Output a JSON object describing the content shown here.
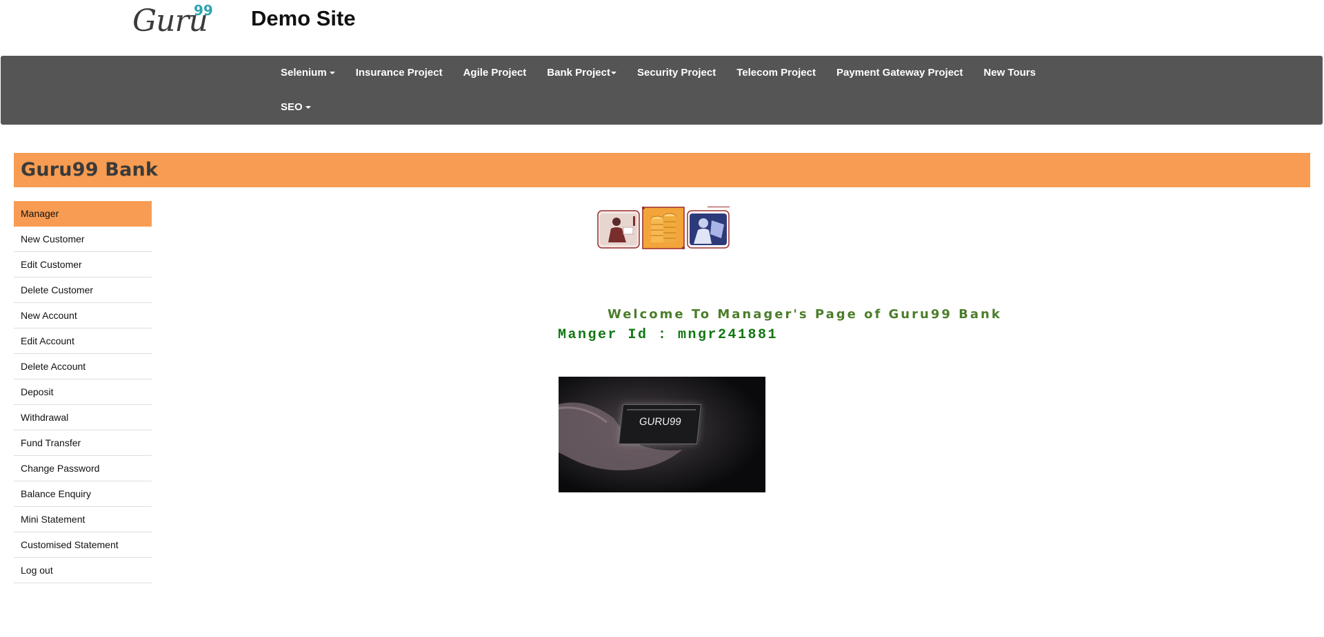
{
  "header": {
    "logo_text": "Guru",
    "logo_sup": "99",
    "site_title": "Demo Site"
  },
  "navbar": {
    "row1": [
      {
        "label": "Selenium",
        "dropdown": true
      },
      {
        "label": "Insurance Project",
        "dropdown": false
      },
      {
        "label": "Agile Project",
        "dropdown": false
      },
      {
        "label": "Bank Project",
        "dropdown": true
      },
      {
        "label": "Security Project",
        "dropdown": false
      },
      {
        "label": "Telecom Project",
        "dropdown": false
      },
      {
        "label": "Payment Gateway Project",
        "dropdown": false
      },
      {
        "label": "New Tours",
        "dropdown": false
      }
    ],
    "row2": [
      {
        "label": "SEO",
        "dropdown": true
      }
    ]
  },
  "bank": {
    "title": "Guru99 Bank"
  },
  "menu": {
    "items": [
      "Manager",
      "New Customer",
      "Edit Customer",
      "Delete Customer",
      "New Account",
      "Edit Account",
      "Delete Account",
      "Deposit",
      "Withdrawal",
      "Fund Transfer",
      "Change Password",
      "Balance Enquiry",
      "Mini Statement",
      "Customised Statement",
      "Log out"
    ],
    "active": "Manager"
  },
  "content": {
    "welcome": "Welcome To Manager's Page of Guru99 Bank",
    "manager_id": "Manger Id : mngr241881",
    "banner_text": "GURU99"
  },
  "colors": {
    "navbar_bg": "#555555",
    "accent_orange": "#f79c52",
    "welcome_green": "#4b7d2a",
    "manager_id_green": "#127612",
    "logo_sup_teal": "#2ea3b0"
  }
}
